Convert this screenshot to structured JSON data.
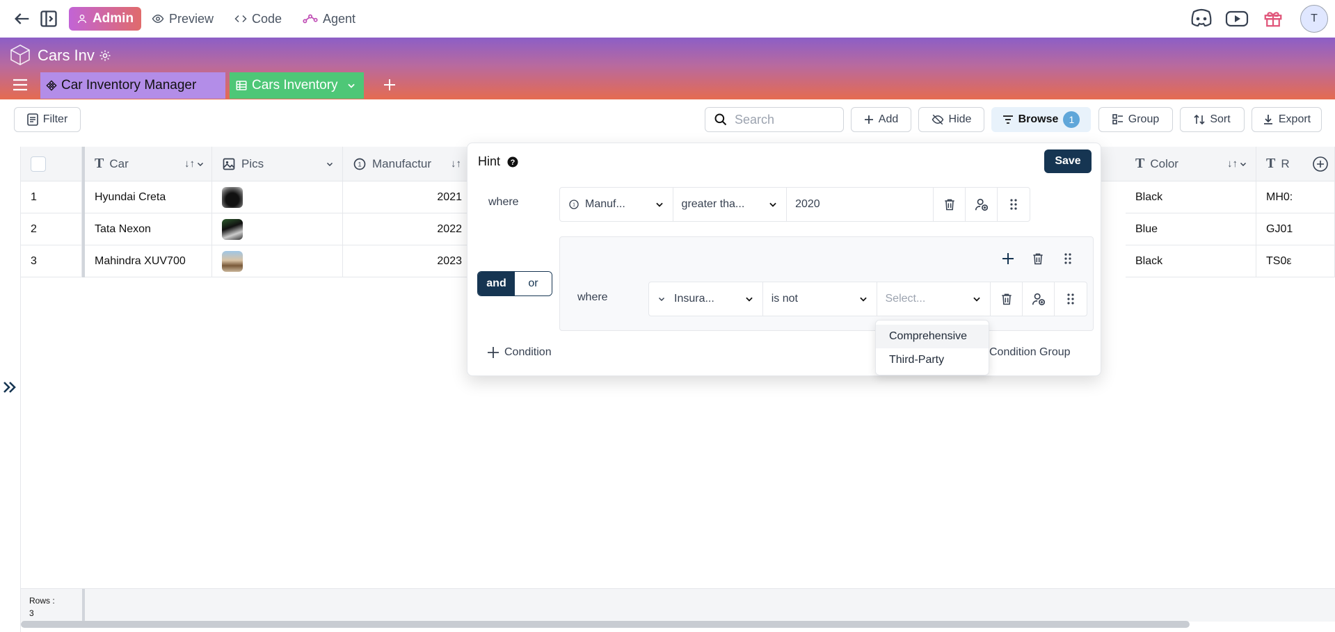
{
  "topbar": {
    "admin": "Admin",
    "preview": "Preview",
    "code": "Code",
    "agent": "Agent",
    "avatar_initial": "T"
  },
  "header": {
    "base_title": "Cars Inv",
    "tabs": [
      {
        "label": "Car Inventory Manager"
      },
      {
        "label": "Cars Inventory"
      }
    ]
  },
  "toolbar": {
    "filter": "Filter",
    "search_placeholder": "Search",
    "add": "Add",
    "hide": "Hide",
    "browse": "Browse",
    "browse_count": "1",
    "group": "Group",
    "sort": "Sort",
    "export": "Export"
  },
  "grid": {
    "columns": [
      "Car",
      "Pics",
      "Manufactur",
      "Color",
      "R"
    ],
    "rows": [
      {
        "n": "1",
        "car": "Hyundai Creta",
        "year": "2021",
        "color": "Black",
        "reg": "MH0:"
      },
      {
        "n": "2",
        "car": "Tata Nexon",
        "year": "2022",
        "color": "Blue",
        "reg": "GJ01"
      },
      {
        "n": "3",
        "car": "Mahindra XUV700",
        "year": "2023",
        "color": "Black",
        "reg": "TS0ε"
      }
    ],
    "footer_rows_label": "Rows :",
    "footer_rows_count": "3"
  },
  "filter_popup": {
    "title": "Hint",
    "save": "Save",
    "where1": "where",
    "field1": "Manuf...",
    "op1": "greater tha...",
    "value1": "2020",
    "and": "and",
    "or": "or",
    "where2": "where",
    "field2": "Insura...",
    "op2": "is not",
    "value2_placeholder": "Select...",
    "options": [
      "Comprehensive",
      "Third-Party"
    ],
    "add_condition": "Condition",
    "add_group": "Condition Group"
  },
  "colors": {
    "accent_dark": "#163552",
    "green_tab": "#4ec777",
    "purple_tab": "#b38de8"
  }
}
